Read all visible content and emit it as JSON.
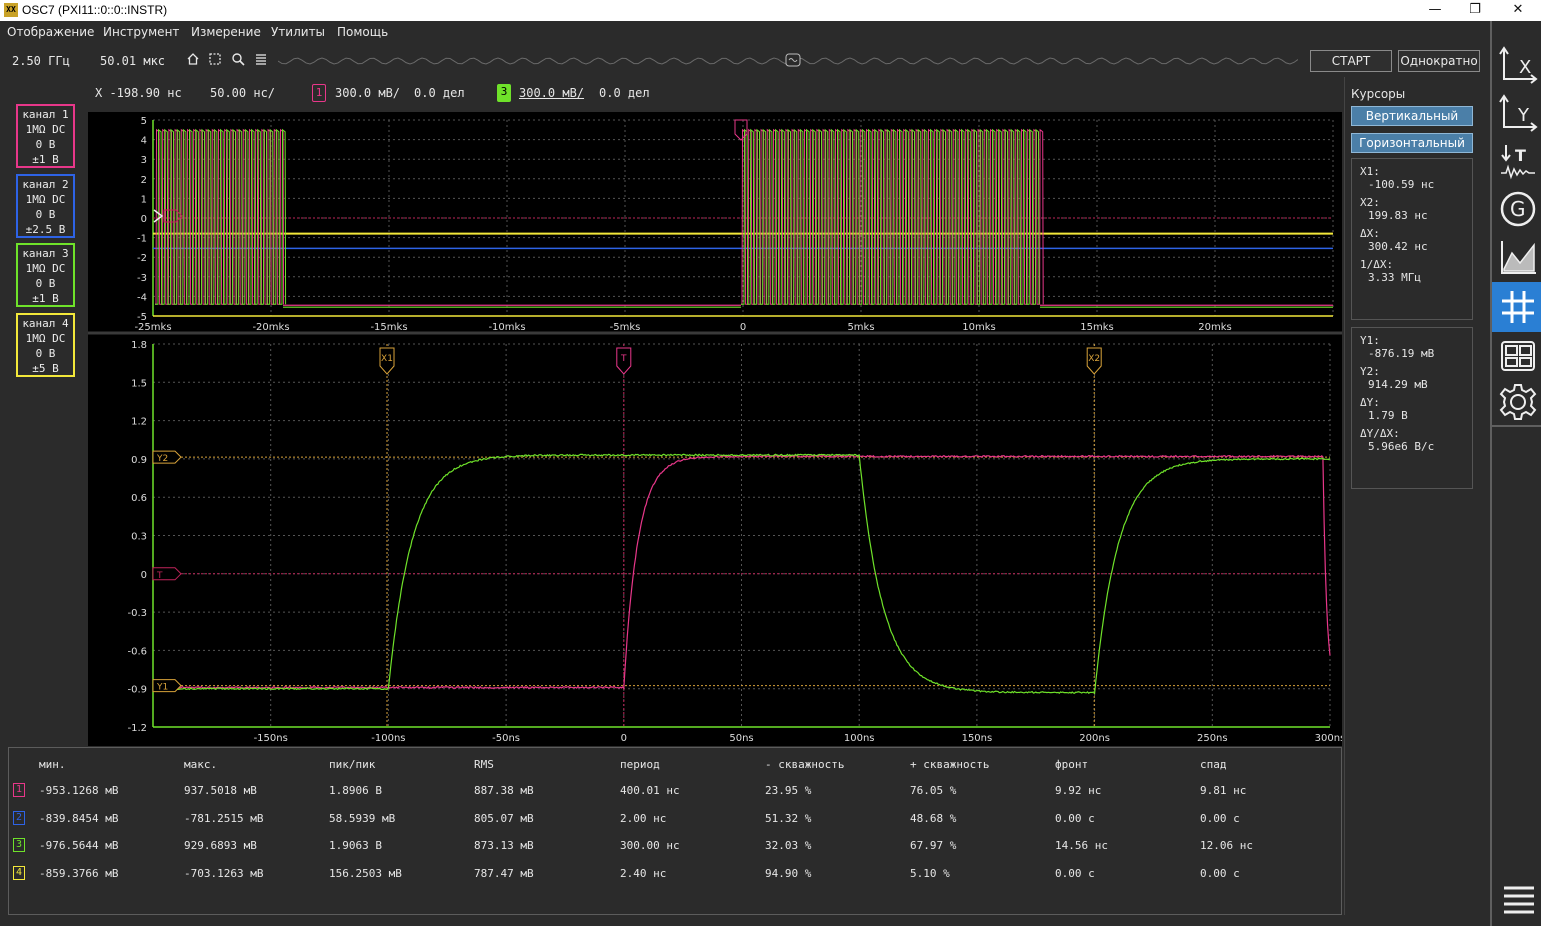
{
  "window": {
    "icon_text": "XX",
    "title": "OSC7 (PXI11::0::0::INSTR)",
    "minimize": "—",
    "maximize": "❐",
    "close": "✕"
  },
  "menu": [
    "Отображение",
    "Инструмент",
    "Измерение",
    "Утилиты",
    "Помощь"
  ],
  "toolbar": {
    "sample_rate": "2.50 ГГц",
    "record_length": "50.01 мкс",
    "start_label": "СТАРТ",
    "single_label": "Однократно"
  },
  "chanbar": {
    "x_pos": "X -198.90 нс",
    "timebase": "50.00 нс/",
    "ch1_num": "1",
    "ch1_scale": "300.0 мВ/",
    "ch1_offset": "0.0 дел",
    "ch3_num": "3",
    "ch3_scale": "300.0 мВ/",
    "ch3_offset": "0.0 дел"
  },
  "channels": [
    {
      "name": "канал 1",
      "coupling": "1MΩ DC",
      "offset": "0 В",
      "range": "±1 В",
      "color": "#e8378a"
    },
    {
      "name": "канал 2",
      "coupling": "1MΩ DC",
      "offset": "0 В",
      "range": "±2.5 В",
      "color": "#2e63e6"
    },
    {
      "name": "канал 3",
      "coupling": "1MΩ DC",
      "offset": "0 В",
      "range": "±1 В",
      "color": "#6fe22a"
    },
    {
      "name": "канал 4",
      "coupling": "1MΩ DC",
      "offset": "0 В",
      "range": "±5 В",
      "color": "#f3e83a"
    }
  ],
  "overview": {
    "y_ticks": [
      "5",
      "4",
      "3",
      "2",
      "1",
      "0",
      "-1",
      "-2",
      "-3",
      "-4",
      "-5"
    ],
    "x_ticks": [
      "-25mks",
      "-20mks",
      "-15mks",
      "-10mks",
      "-5mks",
      "0",
      "5mks",
      "10mks",
      "15mks",
      "20mks"
    ]
  },
  "main_plot": {
    "y_ticks": [
      "1.8",
      "1.5",
      "1.2",
      "0.9",
      "0.6",
      "0.3",
      "0",
      "-0.3",
      "-0.6",
      "-0.9",
      "-1.2"
    ],
    "x_ticks": [
      "-150ns",
      "-100ns",
      "-50ns",
      "0",
      "50ns",
      "100ns",
      "150ns",
      "200ns",
      "250ns",
      "300ns"
    ],
    "cursor_x1": "X1",
    "cursor_x2": "X2",
    "cursor_y2": "Y2",
    "cursor_y1": "Y1",
    "trigger": "T"
  },
  "cursors": {
    "title": "Курсоры",
    "vertical": "Вертикальный",
    "horizontal": "Горизонтальный",
    "x1_label": "X1:",
    "x1": "-100.59 нс",
    "x2_label": "X2:",
    "x2": "199.83 нс",
    "dx_label": "ΔX:",
    "dx": "300.42 нс",
    "inv_dx_label": "1/ΔX:",
    "inv_dx": "3.33 МГц",
    "y1_label": "Y1:",
    "y1": "-876.19 мВ",
    "y2_label": "Y2:",
    "y2": "914.29 мВ",
    "dy_label": "ΔY:",
    "dy": "1.79 В",
    "dydx_label": "ΔY/ΔX:",
    "dydx": "5.96e6 В/с"
  },
  "measurements": {
    "headers": [
      "мин.",
      "макс.",
      "пик/пик",
      "RMS",
      "период",
      "- скважность",
      "+ скважность",
      "фронт",
      "спад"
    ],
    "rows": [
      {
        "ch": "1",
        "color": "#e8378a",
        "values": [
          "-953.1268 мВ",
          "937.5018 мВ",
          "1.8906 В",
          "887.38 мВ",
          "400.01 нс",
          "23.95 %",
          "76.05 %",
          "9.92 нс",
          "9.81 нс"
        ]
      },
      {
        "ch": "2",
        "color": "#2e63e6",
        "values": [
          "-839.8454 мВ",
          "-781.2515 мВ",
          "58.5939 мВ",
          "805.07 мВ",
          "2.00 нс",
          "51.32 %",
          "48.68 %",
          "0.00 с",
          "0.00 с"
        ]
      },
      {
        "ch": "3",
        "color": "#6fe22a",
        "values": [
          "-976.5644 мВ",
          "929.6893 мВ",
          "1.9063 В",
          "873.13 мВ",
          "300.00 нс",
          "32.03 %",
          "67.97 %",
          "14.56 нс",
          "12.06 нс"
        ]
      },
      {
        "ch": "4",
        "color": "#f3e83a",
        "values": [
          "-859.3766 мВ",
          "-703.1263 мВ",
          "156.2503 мВ",
          "787.47 мВ",
          "2.40 нс",
          "94.90 %",
          "5.10 %",
          "0.00 с",
          "0.00 с"
        ]
      }
    ]
  },
  "sidebar_icons": [
    "x-axis-icon",
    "y-axis-icon",
    "trigger-icon",
    "generator-icon",
    "chart-icon",
    "grid-icon",
    "layout-icon",
    "settings-icon",
    "menu-icon"
  ],
  "sidebar_labels": {
    "x": "X",
    "y": "Y",
    "trig": "T",
    "gen": "G"
  }
}
